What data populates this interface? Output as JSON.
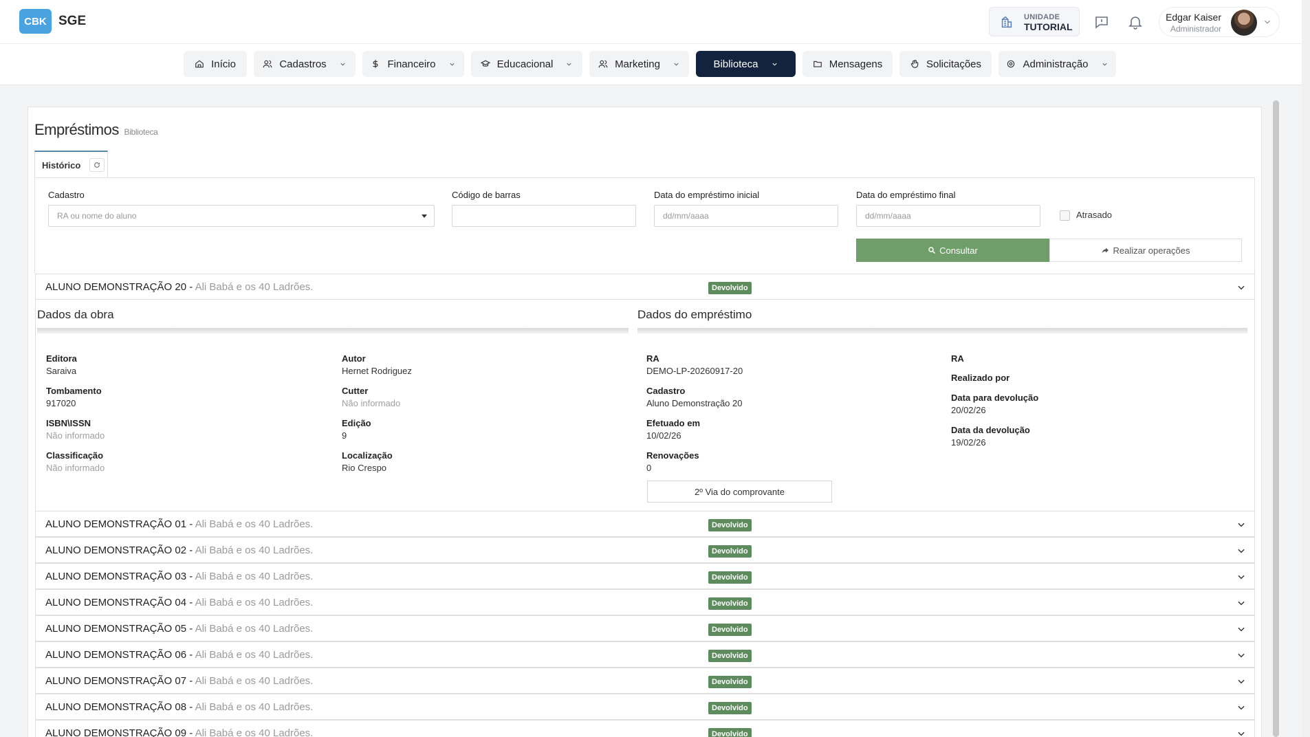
{
  "header": {
    "logo": "CBK",
    "app_name": "SGE",
    "unit_label": "UNIDADE",
    "unit_value": "TUTORIAL",
    "user_name": "Edgar Kaiser",
    "user_role": "Administrador"
  },
  "nav": {
    "items": [
      {
        "label": "Início",
        "icon": "home-icon",
        "dropdown": false
      },
      {
        "label": "Cadastros",
        "icon": "users-icon",
        "dropdown": true
      },
      {
        "label": "Financeiro",
        "icon": "dollar-icon",
        "dropdown": true
      },
      {
        "label": "Educacional",
        "icon": "graduation-cap-icon",
        "dropdown": true
      },
      {
        "label": "Marketing",
        "icon": "users-icon",
        "dropdown": true
      },
      {
        "label": "Biblioteca",
        "icon": "book-icon",
        "dropdown": true,
        "active": true
      },
      {
        "label": "Mensagens",
        "icon": "folder-icon",
        "dropdown": false
      },
      {
        "label": "Solicitações",
        "icon": "hand-icon",
        "dropdown": false
      },
      {
        "label": "Administração",
        "icon": "gear-icon",
        "dropdown": true
      }
    ]
  },
  "page": {
    "title": "Empréstimos",
    "subtitle": "Biblioteca",
    "tab_label": "Histórico"
  },
  "filters": {
    "cadastro_label": "Cadastro",
    "cadastro_placeholder": "RA ou nome do aluno",
    "codigo_label": "Código de barras",
    "codigo_value": "",
    "data_inicial_label": "Data do empréstimo inicial",
    "data_inicial_placeholder": "dd/mm/aaaa",
    "data_final_label": "Data do empréstimo final",
    "data_final_placeholder": "dd/mm/aaaa",
    "atrasado_label": "Atrasado",
    "atrasado_checked": false,
    "consultar_label": "Consultar",
    "operacoes_label": "Realizar operações"
  },
  "colors": {
    "accent_dark": "#13233d",
    "success": "#6f9e6b",
    "badge": "#5e8b5e",
    "logo": "#4aa3df"
  },
  "loans": [
    {
      "student": "ALUNO DEMONSTRAÇÃO 20",
      "book": "Ali Babá e os 40 Ladrões.",
      "status": "Devolvido",
      "expanded": true
    },
    {
      "student": "ALUNO DEMONSTRAÇÃO 01",
      "book": "Ali Babá e os 40 Ladrões.",
      "status": "Devolvido"
    },
    {
      "student": "ALUNO DEMONSTRAÇÃO 02",
      "book": "Ali Babá e os 40 Ladrões.",
      "status": "Devolvido"
    },
    {
      "student": "ALUNO DEMONSTRAÇÃO 03",
      "book": "Ali Babá e os 40 Ladrões.",
      "status": "Devolvido"
    },
    {
      "student": "ALUNO DEMONSTRAÇÃO 04",
      "book": "Ali Babá e os 40 Ladrões.",
      "status": "Devolvido"
    },
    {
      "student": "ALUNO DEMONSTRAÇÃO 05",
      "book": "Ali Babá e os 40 Ladrões.",
      "status": "Devolvido"
    },
    {
      "student": "ALUNO DEMONSTRAÇÃO 06",
      "book": "Ali Babá e os 40 Ladrões.",
      "status": "Devolvido"
    },
    {
      "student": "ALUNO DEMONSTRAÇÃO 07",
      "book": "Ali Babá e os 40 Ladrões.",
      "status": "Devolvido"
    },
    {
      "student": "ALUNO DEMONSTRAÇÃO 08",
      "book": "Ali Babá e os 40 Ladrões.",
      "status": "Devolvido"
    },
    {
      "student": "ALUNO DEMONSTRAÇÃO 09",
      "book": "Ali Babá e os 40 Ladrões.",
      "status": "Devolvido"
    }
  ],
  "detail": {
    "obra_title": "Dados da obra",
    "emprestimo_title": "Dados do empréstimo",
    "editora_label": "Editora",
    "editora": "Saraiva",
    "tombamento_label": "Tombamento",
    "tombamento": "917020",
    "isbn_label": "ISBN\\ISSN",
    "isbn": "Não informado",
    "classificacao_label": "Classificação",
    "classificacao": "Não informado",
    "autor_label": "Autor",
    "autor": "Hernet Rodriguez",
    "cutter_label": "Cutter",
    "cutter": "Não informado",
    "edicao_label": "Edição",
    "edicao": "9",
    "localizacao_label": "Localização",
    "localizacao": "Rio Crespo",
    "ra_label": "RA",
    "ra": "DEMO-LP-20260917-20",
    "cadastro_label": "Cadastro",
    "cadastro": "Aluno Demonstração 20",
    "efetuado_label": "Efetuado em",
    "efetuado": "10/02/26",
    "renovacoes_label": "Renovações",
    "renovacoes": "0",
    "ra2_label": "RA",
    "realizado_label": "Realizado por",
    "data_prevista_label": "Data para devolução",
    "data_prevista": "20/02/26",
    "data_devolucao_label": "Data da devolução",
    "data_devolucao": "19/02/26",
    "via_label": "2º Via do comprovante"
  }
}
